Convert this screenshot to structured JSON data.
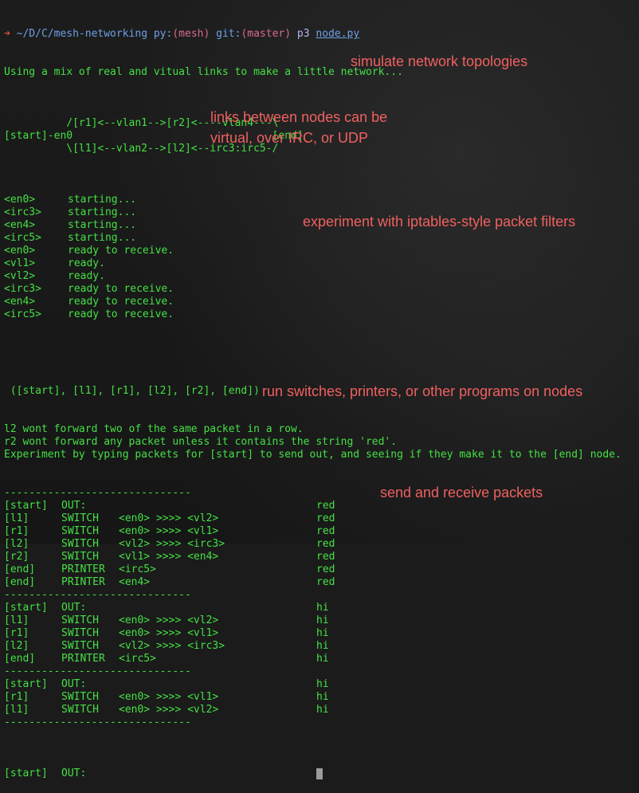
{
  "prompt": {
    "arrow": "➜",
    "path": "~/D/C/mesh-networking",
    "py_label": "py:",
    "py_env": "(mesh)",
    "git_label": "git:",
    "git_branch": "(master)",
    "command": "p3",
    "file": "node.py"
  },
  "intro": "Using a mix of real and vitual links to make a little network...",
  "topology": [
    "",
    "          /[r1]<--vlan1-->[r2]<----vlan4---\\",
    "[start]-en0                                [end]",
    "          \\[l1]<--vlan2-->[l2]<--irc3:irc5-/",
    ""
  ],
  "startup": [
    {
      "tag": "<en0>",
      "msg": "starting..."
    },
    {
      "tag": "<irc3>",
      "msg": "starting..."
    },
    {
      "tag": "<en4>",
      "msg": "starting..."
    },
    {
      "tag": "<irc5>",
      "msg": "starting..."
    },
    {
      "tag": "<en0>",
      "msg": "ready to receive."
    },
    {
      "tag": "<vl1>",
      "msg": "ready."
    },
    {
      "tag": "<vl2>",
      "msg": "ready."
    },
    {
      "tag": "<irc3>",
      "msg": "ready to receive."
    },
    {
      "tag": "<en4>",
      "msg": "ready to receive."
    },
    {
      "tag": "<irc5>",
      "msg": "ready to receive."
    }
  ],
  "node_list": " ([start], [l1], [r1], [l2], [r2], [end])",
  "rules": [
    "l2 wont forward two of the same packet in a row.",
    "r2 wont forward any packet unless it contains the string 'red'.",
    "Experiment by typing packets for [start] to send out, and seeing if they make it to the [end] node."
  ],
  "separator": "------------------------------",
  "blocks": [
    [
      {
        "node": "[start]",
        "action": "OUT:",
        "route": "",
        "payload": "red"
      },
      {
        "node": "[l1]",
        "action": "SWITCH",
        "route": "<en0> >>>> <vl2>",
        "payload": "red"
      },
      {
        "node": "[r1]",
        "action": "SWITCH",
        "route": "<en0> >>>> <vl1>",
        "payload": "red"
      },
      {
        "node": "[l2]",
        "action": "SWITCH",
        "route": "<vl2> >>>> <irc3>",
        "payload": "red"
      },
      {
        "node": "[r2]",
        "action": "SWITCH",
        "route": "<vl1> >>>> <en4>",
        "payload": "red"
      },
      {
        "node": "[end]",
        "action": "PRINTER",
        "route": "<irc5>",
        "payload": "red"
      },
      {
        "node": "[end]",
        "action": "PRINTER",
        "route": "<en4>",
        "payload": "red"
      }
    ],
    [
      {
        "node": "[start]",
        "action": "OUT:",
        "route": "",
        "payload": "hi"
      },
      {
        "node": "[l1]",
        "action": "SWITCH",
        "route": "<en0> >>>> <vl2>",
        "payload": "hi"
      },
      {
        "node": "[r1]",
        "action": "SWITCH",
        "route": "<en0> >>>> <vl1>",
        "payload": "hi"
      },
      {
        "node": "[l2]",
        "action": "SWITCH",
        "route": "<vl2> >>>> <irc3>",
        "payload": "hi"
      },
      {
        "node": "[end]",
        "action": "PRINTER",
        "route": "<irc5>",
        "payload": "hi"
      }
    ],
    [
      {
        "node": "[start]",
        "action": "OUT:",
        "route": "",
        "payload": "hi"
      },
      {
        "node": "[r1]",
        "action": "SWITCH",
        "route": "<en0> >>>> <vl1>",
        "payload": "hi"
      },
      {
        "node": "[l1]",
        "action": "SWITCH",
        "route": "<en0> >>>> <vl2>",
        "payload": "hi"
      }
    ]
  ],
  "final_prompt": {
    "node": "[start]",
    "action": "OUT:"
  },
  "annotations": {
    "topologies": "simulate network topologies",
    "links": "links between nodes can be\nvirtual, over IRC, or UDP",
    "filters": "experiment with iptables-style packet filters",
    "programs": "run switches, printers, or other programs on nodes",
    "packets": "send and receive packets"
  },
  "colors": {
    "terminal_text": "#45e045",
    "annotation": "#f06060",
    "background": "#1b1b1b"
  }
}
